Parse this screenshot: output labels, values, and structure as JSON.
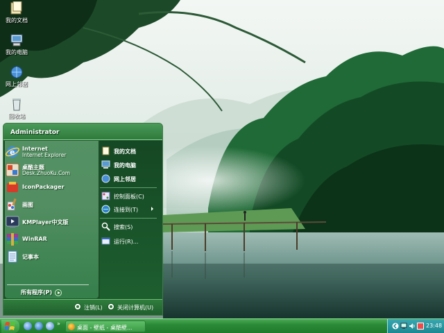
{
  "desktop": {
    "icons": [
      {
        "label": "我的文档",
        "icon": "my-documents-icon"
      },
      {
        "label": "我的电脑",
        "icon": "my-computer-icon"
      },
      {
        "label": "网上邻居",
        "icon": "network-places-icon"
      },
      {
        "label": "回收站",
        "icon": "recycle-bin-icon"
      }
    ]
  },
  "start_menu": {
    "user": "Administrator",
    "pinned": [
      {
        "title": "Internet",
        "subtitle": "Internet Explorer",
        "icon": "internet-explorer-icon"
      },
      {
        "title": "桌酷主题",
        "subtitle": "Desk.ZhuoKu.Com",
        "icon": "zhuoku-theme-icon"
      },
      {
        "title": "IconPackager",
        "icon": "iconpackager-icon"
      },
      {
        "title": "画图",
        "icon": "paint-icon"
      },
      {
        "title": "KMPlayer中文版",
        "icon": "kmplayer-icon"
      },
      {
        "title": "WinRAR",
        "icon": "winrar-icon"
      },
      {
        "title": "记事本",
        "icon": "notepad-icon"
      }
    ],
    "all_programs": "所有程序(P)",
    "places": [
      {
        "label": "我的文档",
        "icon": "my-documents-icon"
      },
      {
        "label": "我的电脑",
        "icon": "my-computer-icon"
      },
      {
        "label": "网上邻居",
        "icon": "network-places-icon"
      }
    ],
    "system": [
      {
        "label": "控制面板(C)",
        "icon": "control-panel-icon"
      },
      {
        "label": "连接到(T)",
        "icon": "connect-to-icon"
      }
    ],
    "tools": [
      {
        "label": "搜索(S)",
        "icon": "search-icon"
      },
      {
        "label": "运行(R)...",
        "icon": "run-icon"
      }
    ],
    "logoff": "注销(L)",
    "shutdown": "关闭计算机(U)"
  },
  "taskbar": {
    "quicklaunch": [
      "show-desktop-icon",
      "ie-icon",
      "media-icon"
    ],
    "more": "»",
    "task_label": "桌面 - 壁纸 - 桌酷壁...",
    "clock": "23:48"
  },
  "colors": {
    "taskbar_green": "#2a8a36",
    "tray_teal": "#1c8892",
    "menu_green": "#1b4e26"
  }
}
